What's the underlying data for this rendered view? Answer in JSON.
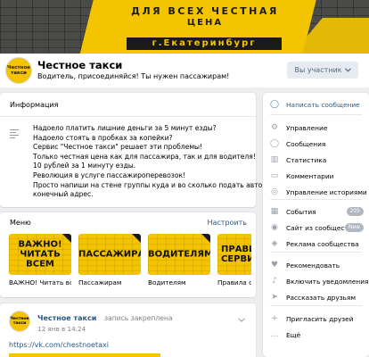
{
  "cover": {
    "line1": "ДЛЯ ВСЕХ ЧЕСТНАЯ",
    "line2": "ЦЕНА",
    "city": "г.Екатеринбург",
    "accent_color": "#f5c400"
  },
  "group": {
    "logo_line1": "Честное",
    "logo_line2": "такси",
    "name": "Честное такси",
    "status": "Водитель, присоединяйся! Ты нужен пассажирам!",
    "member_button": "Вы участник",
    "member_chevron": "chevron-down-icon"
  },
  "info": {
    "title": "Информация",
    "icon": "lines-icon",
    "lines": [
      "Надоело платить лишние деньги за 5 минут езды?",
      "Надоело стоять в пробках за копейки?",
      "Сервис \"Честное такси\" решает эти проблемы!",
      "Только честная цена как для пассажира, так и для водителя!",
      "10 рублей за 1 минуту езды.",
      "Революция в услуге пассажироперевозок!",
      "Просто напиши на стене группы куда и во сколько подать авто и",
      "конечный адрес."
    ]
  },
  "menu": {
    "title": "Меню",
    "setup_link": "Настроить",
    "items": [
      {
        "image_text": "ВАЖНО! ЧИТАТЬ ВСЕМ",
        "caption": "ВАЖНО! Читать все..."
      },
      {
        "image_text": "ПАССАЖИРАМ",
        "caption": "Пассажирам"
      },
      {
        "image_text": "ВОДИТЕЛЯМ",
        "caption": "Водителям"
      },
      {
        "image_text": "ПРАВИ СЕРВИ",
        "caption": "Правила се"
      }
    ]
  },
  "post": {
    "logo_line1": "Честное",
    "logo_line2": "такси",
    "author": "Честное такси",
    "pinned": "запись закреплена",
    "date": "12 янв в 14:24",
    "link": "https://vk.com/chestnoetaxi"
  },
  "sidebar": {
    "items": [
      {
        "icon": "chat-bubble-icon",
        "glyph": "◯",
        "label": "Написать сообщение"
      },
      {
        "icon": "gear-icon",
        "glyph": "⚙",
        "label": "Управление"
      },
      {
        "icon": "message-icon",
        "glyph": "◯",
        "label": "Сообщения"
      },
      {
        "icon": "stats-icon",
        "glyph": "▥",
        "label": "Статистика"
      },
      {
        "icon": "comment-icon",
        "glyph": "▭",
        "label": "Комментарии"
      },
      {
        "icon": "stories-icon",
        "glyph": "◎",
        "label": "Управление историями"
      },
      {
        "icon": "calendar-icon",
        "glyph": "▦",
        "label": "События",
        "badge": "205"
      },
      {
        "icon": "app-icon",
        "glyph": "◉",
        "label": "Сайт из сообщества",
        "badge": "New"
      },
      {
        "icon": "megaphone-icon",
        "glyph": "◈",
        "label": "Реклама сообщества"
      },
      {
        "icon": "like-icon",
        "glyph": "♥",
        "label": "Рекомендовать"
      },
      {
        "icon": "bell-icon",
        "glyph": "♪",
        "label": "Включить уведомления"
      },
      {
        "icon": "megaphone-share-icon",
        "glyph": "➤",
        "label": "Рассказать друзьям"
      },
      {
        "icon": "add-user-icon",
        "glyph": "+",
        "label": "Пригласить друзей"
      },
      {
        "icon": "more-icon",
        "glyph": "…",
        "label": "Ещё"
      }
    ]
  }
}
